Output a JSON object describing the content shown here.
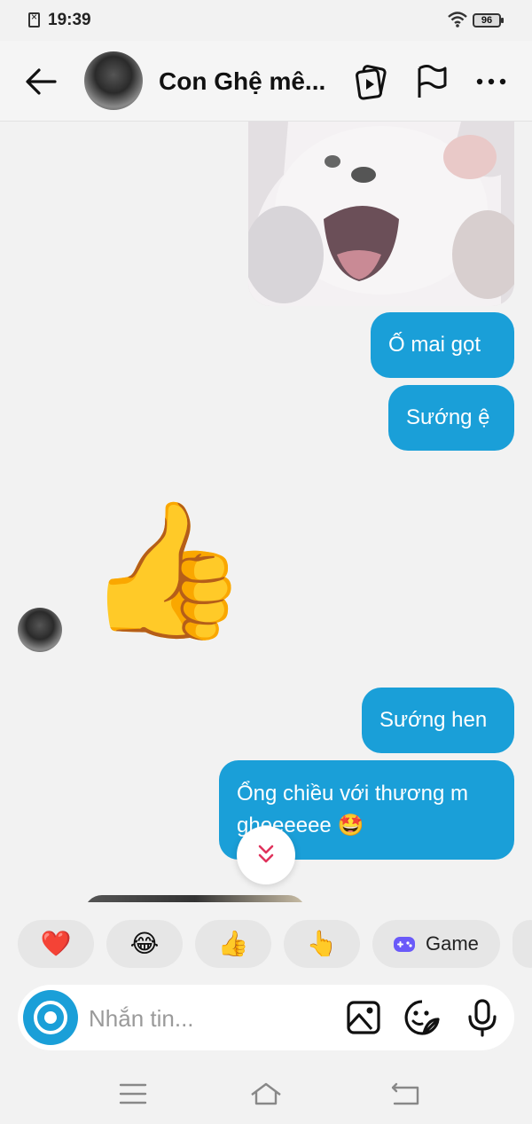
{
  "status": {
    "time": "19:39",
    "battery": "96"
  },
  "header": {
    "title": "Con Ghệ mê..."
  },
  "messages": {
    "sent1": "Ố mai gọt",
    "sent2": "Sướng ệ",
    "received_emoji": "👍",
    "sent3": "Sướng hen",
    "sent4_line1": "Ổng chiều với thương m",
    "sent4_line2": "gheeeeee 🤩"
  },
  "quick_reactions": [
    "❤️",
    "😂",
    "👍",
    "👆"
  ],
  "game_chip": {
    "label": "Game"
  },
  "input": {
    "placeholder": "Nhắn tin..."
  },
  "colors": {
    "accent": "#1a9fd8",
    "background": "#f2f2f2"
  }
}
